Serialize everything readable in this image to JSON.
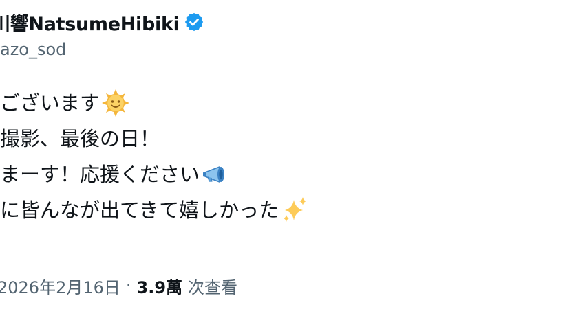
{
  "tweet": {
    "display_name": "川響NatsumeHibiki",
    "handle": "azo_sod",
    "verified_color": "#1d9bf0",
    "lines": [
      {
        "text": "ございます",
        "emoji": "sun-face-emoji"
      },
      {
        "text": "撮影、最後の日！",
        "emoji": null
      },
      {
        "text": "まーす！応援ください",
        "emoji": "megaphone-emoji"
      },
      {
        "text": "に皆んなが出てきて嬉しかった",
        "emoji": "sparkles-emoji"
      }
    ],
    "line_0": "ございます",
    "line_1": "撮影、最後の日！",
    "line_2": "まーす！応援ください",
    "line_3": "に皆んなが出てきて嬉しかった"
  },
  "meta": {
    "timestamp": "2026年2月16日",
    "separator": "·",
    "views_count": "3.9萬",
    "views_label": "次查看"
  },
  "colors": {
    "text": "#0f1419",
    "secondary": "#536471",
    "accent": "#1d9bf0"
  }
}
